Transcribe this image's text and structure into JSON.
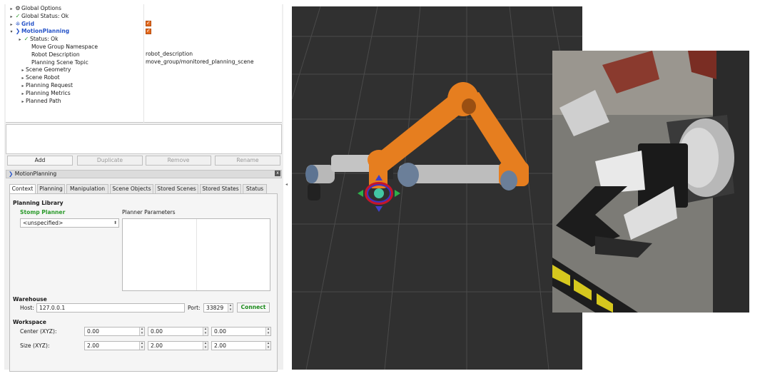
{
  "tree": {
    "items": [
      {
        "arrow": "▸",
        "icon": "⚙",
        "label": "Global Options",
        "style": "normal"
      },
      {
        "arrow": "▸",
        "icon": "✓",
        "label": "Global Status: Ok",
        "style": "normal"
      },
      {
        "arrow": "▸",
        "icon": "⁜",
        "label": "Grid",
        "style": "blue"
      },
      {
        "arrow": "▾",
        "icon": "❯",
        "label": "MotionPlanning",
        "style": "blue"
      },
      {
        "arrow": "▸",
        "icon": "✓",
        "label": "Status: Ok",
        "style": "normal"
      },
      {
        "arrow": "",
        "icon": "",
        "label": "Move Group Namespace",
        "style": "normal"
      },
      {
        "arrow": "",
        "icon": "",
        "label": "Robot Description",
        "style": "normal"
      },
      {
        "arrow": "",
        "icon": "",
        "label": "Planning Scene Topic",
        "style": "normal"
      },
      {
        "arrow": "▸",
        "icon": "",
        "label": "Scene Geometry",
        "style": "normal"
      },
      {
        "arrow": "▸",
        "icon": "",
        "label": "Scene Robot",
        "style": "normal"
      },
      {
        "arrow": "▸",
        "icon": "",
        "label": "Planning Request",
        "style": "normal"
      },
      {
        "arrow": "▸",
        "icon": "",
        "label": "Planning Metrics",
        "style": "normal"
      },
      {
        "arrow": "▸",
        "icon": "",
        "label": "Planned Path",
        "style": "normal"
      }
    ],
    "values": {
      "robot_description": "robot_description",
      "planning_scene_topic": "move_group/monitored_planning_scene"
    }
  },
  "buttons": {
    "add": "Add",
    "duplicate": "Duplicate",
    "remove": "Remove",
    "rename": "Rename"
  },
  "panel": {
    "title": "MotionPlanning",
    "close": "x"
  },
  "tabs": [
    "Context",
    "Planning",
    "Manipulation",
    "Scene Objects",
    "Stored Scenes",
    "Stored States",
    "Status"
  ],
  "context": {
    "planning_library_heading": "Planning Library",
    "planner_name": "Stomp Planner",
    "planner_select": "<unspecified>",
    "planner_parameters_label": "Planner Parameters",
    "warehouse_heading": "Warehouse",
    "host_label": "Host:",
    "host_value": "127.0.0.1",
    "port_label": "Port:",
    "port_value": "33829",
    "connect_label": "Connect",
    "workspace_heading": "Workspace",
    "center_label": "Center (XYZ):",
    "center_values": [
      "0.00",
      "0.00",
      "0.00"
    ],
    "size_label": "Size (XYZ):",
    "size_values": [
      "2.00",
      "2.00",
      "2.00"
    ]
  },
  "colors": {
    "robot_orange": "#e67e1f",
    "viewport_bg": "#303030",
    "link_blue": "#2855c9",
    "ok_green": "#2a9a2a"
  }
}
